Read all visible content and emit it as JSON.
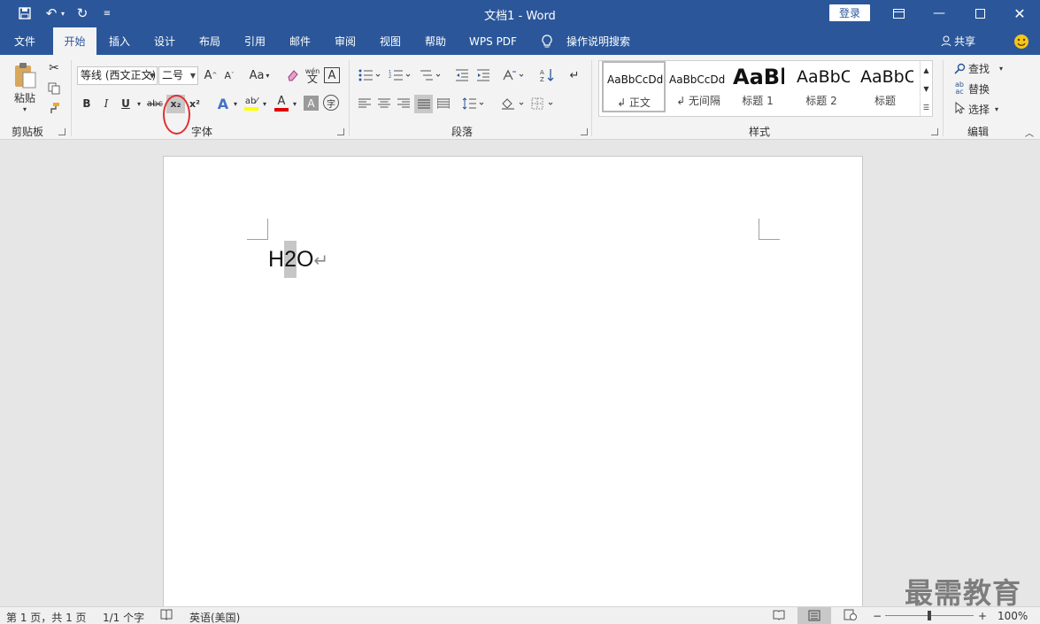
{
  "window": {
    "title": "文档1 - Word",
    "login_label": "登录",
    "share_label": "共享"
  },
  "tabs": [
    {
      "label": "文件"
    },
    {
      "label": "开始"
    },
    {
      "label": "插入"
    },
    {
      "label": "设计"
    },
    {
      "label": "布局"
    },
    {
      "label": "引用"
    },
    {
      "label": "邮件"
    },
    {
      "label": "审阅"
    },
    {
      "label": "视图"
    },
    {
      "label": "帮助"
    },
    {
      "label": "WPS PDF"
    },
    {
      "label": "操作说明搜索"
    }
  ],
  "ribbon": {
    "clipboard": {
      "paste_label": "粘贴",
      "group_label": "剪贴板"
    },
    "font": {
      "font_name": "等线 (西文正文)",
      "font_size": "二号",
      "group_label": "字体",
      "bold": "B",
      "italic": "I",
      "underline": "U",
      "strike": "abc",
      "subscript": "x₂",
      "superscript": "x²",
      "case": "Aa",
      "phonetic": "wén"
    },
    "paragraph": {
      "group_label": "段落"
    },
    "styles": {
      "group_label": "样式",
      "items": [
        {
          "sample": "AaBbCcDd",
          "name": "↲ 正文"
        },
        {
          "sample": "AaBbCcDd",
          "name": "↲ 无间隔"
        },
        {
          "sample": "AaBl",
          "name": "标题 1"
        },
        {
          "sample": "AaBbC",
          "name": "标题 2"
        },
        {
          "sample": "AaBbC",
          "name": "标题"
        }
      ]
    },
    "editing": {
      "group_label": "编辑",
      "find_label": "查找",
      "replace_label": "替换",
      "select_label": "选择"
    }
  },
  "document": {
    "text_before": "H",
    "text_selected": "2",
    "text_after": "O",
    "paragraph_mark": "↵"
  },
  "statusbar": {
    "page": "第 1 页，共 1 页",
    "words": "1/1 个字",
    "language": "英语(美国)",
    "zoom": "100%",
    "zoom_level": 0.5
  },
  "watermark": "最需教育",
  "colors": {
    "accent": "#2b579a",
    "highlight": "#ffff00",
    "font_color": "#e00000",
    "annotation": "#e03030"
  }
}
